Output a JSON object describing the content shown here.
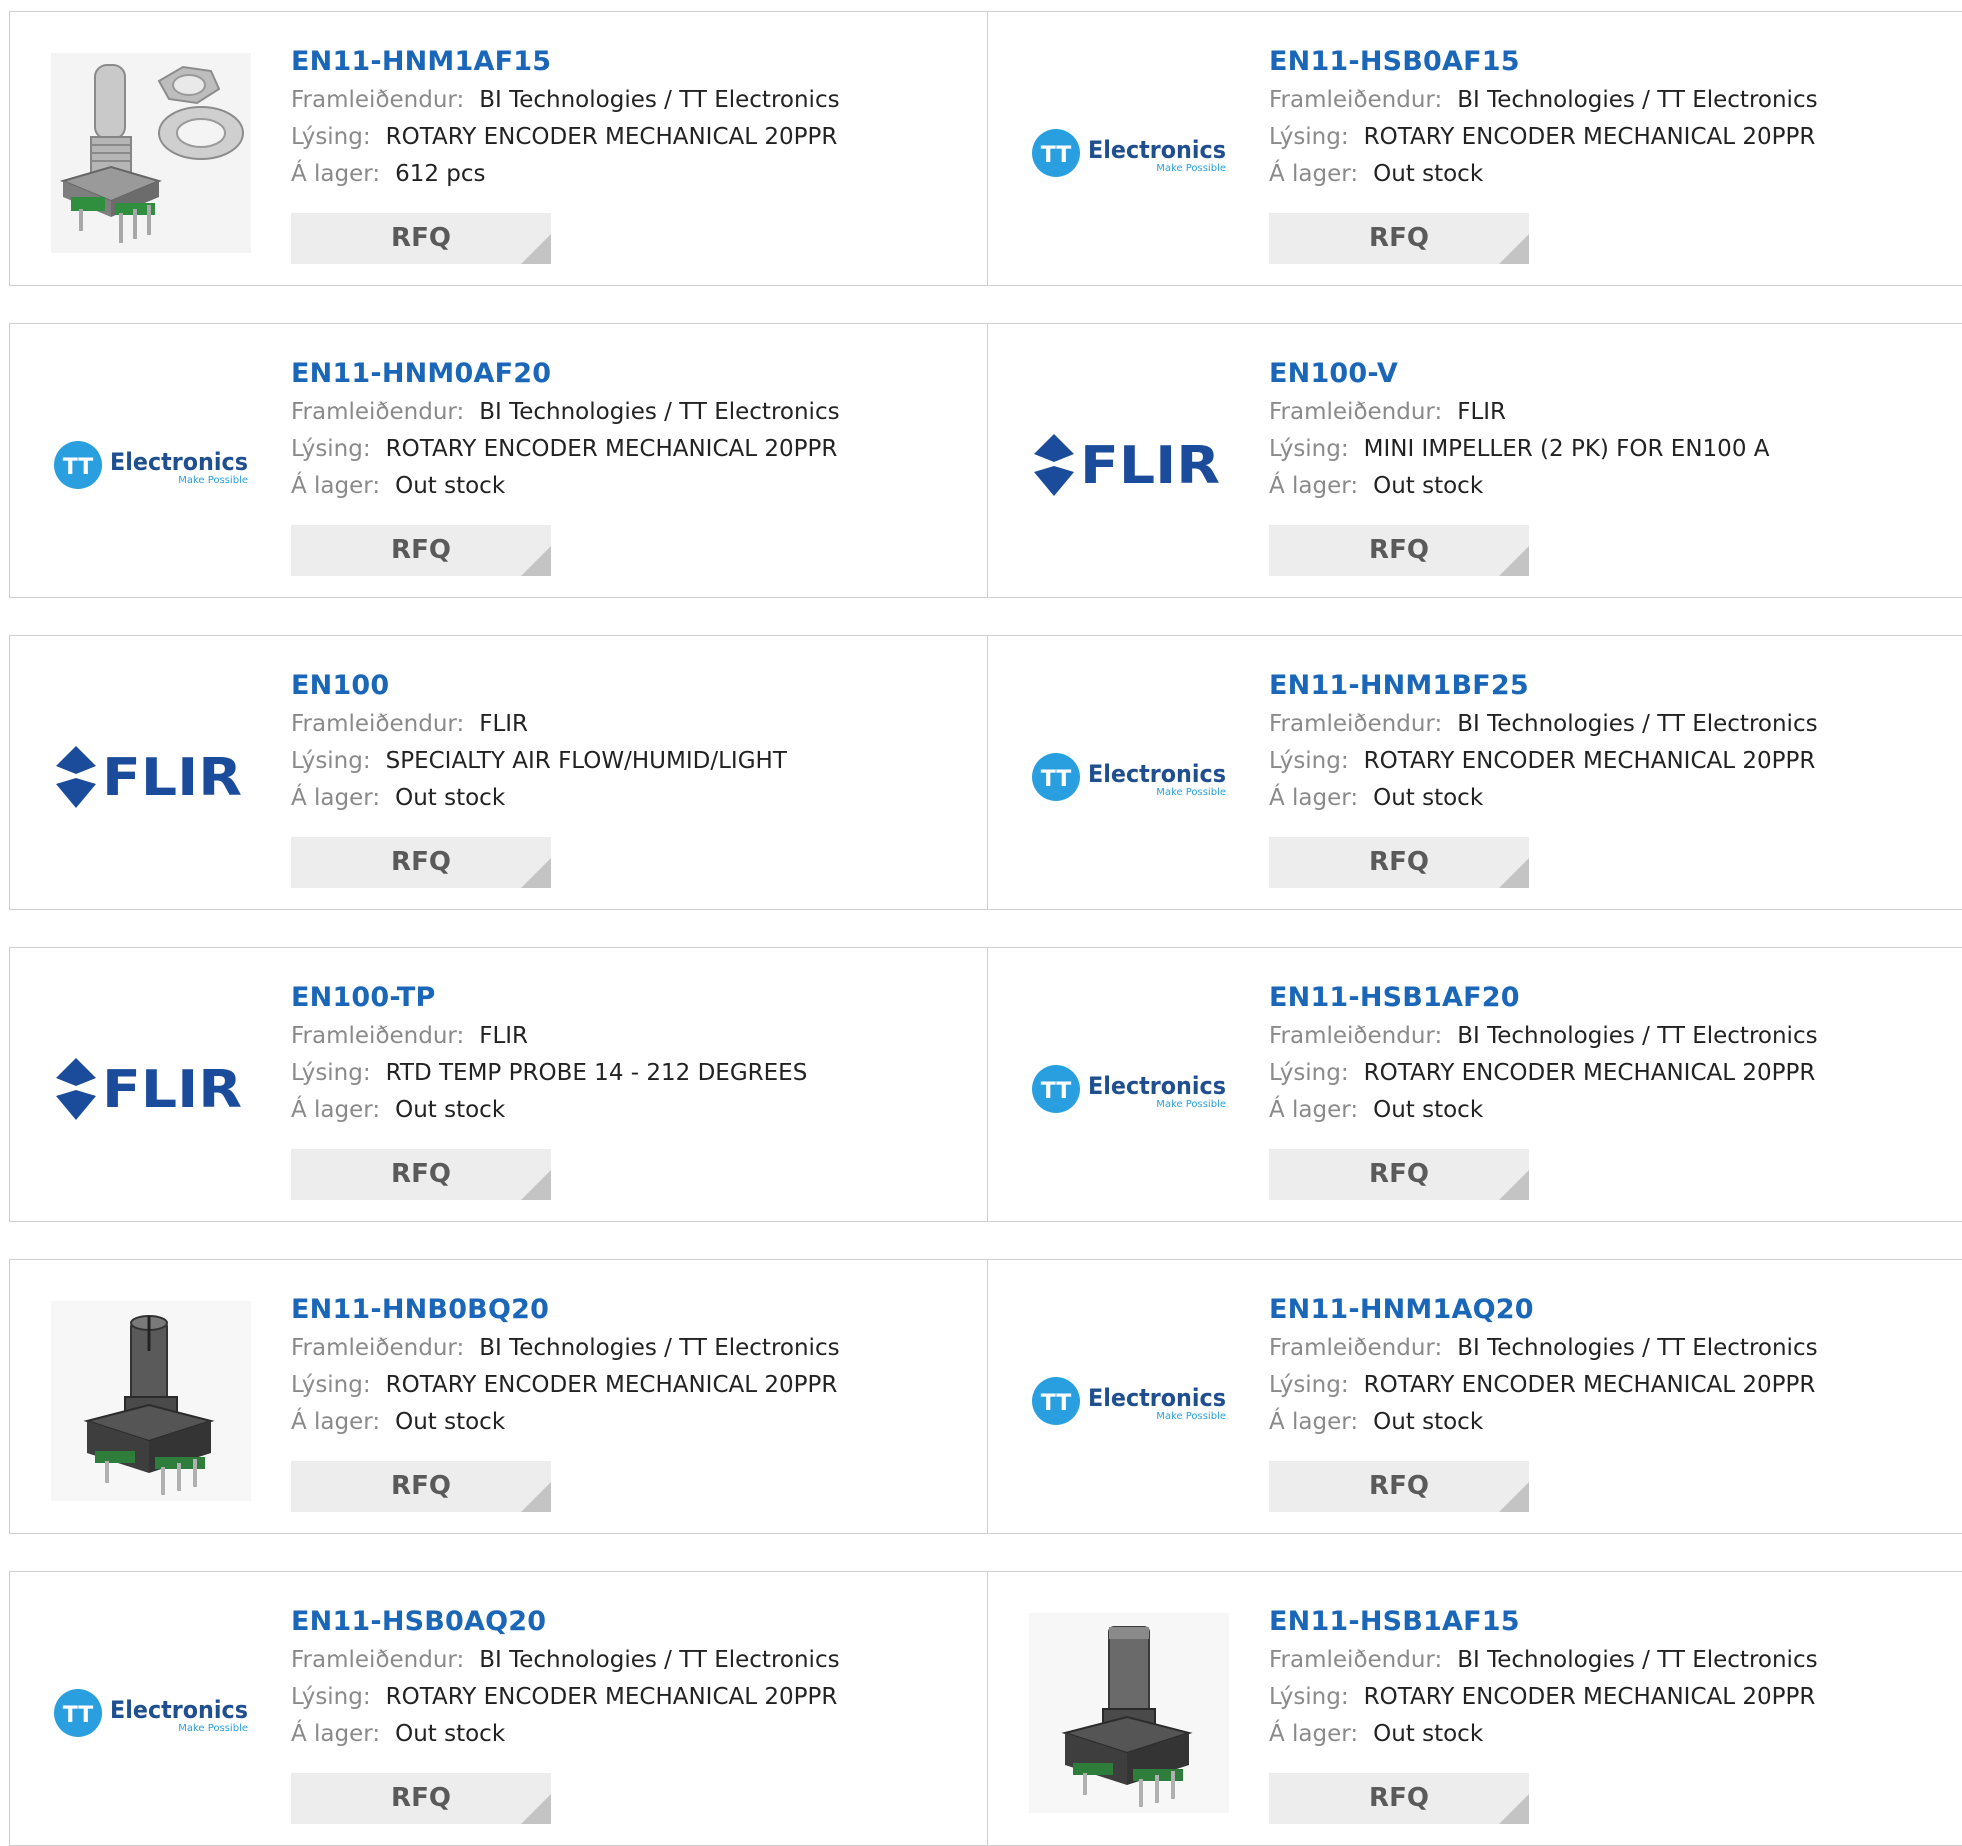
{
  "labels": {
    "manufacturer": "Framleiðendur:",
    "description": "Lýsing:",
    "stock": "Á lager:",
    "rfq": "RFQ"
  },
  "colors": {
    "link": "#1a66b8",
    "label": "#8a8a8a",
    "border": "#cfcfcf",
    "button_bg": "#ededed",
    "tt_blue": "#2a9fe0",
    "flir_blue": "#1b4c9c"
  },
  "brands": {
    "tt": {
      "name": "Electronics",
      "tagline": "Make Possible",
      "mark": "TT"
    },
    "flir": {
      "name": "FLIR"
    }
  },
  "products": [
    {
      "part": "EN11-HNM1AF15",
      "manufacturer": "BI Technologies / TT Electronics",
      "description": "ROTARY ENCODER MECHANICAL 20PPR",
      "stock": "612 pcs",
      "image": "encoder-with-nut-photo"
    },
    {
      "part": "EN11-HSB0AF15",
      "manufacturer": "BI Technologies / TT Electronics",
      "description": "ROTARY ENCODER MECHANICAL 20PPR",
      "stock": "Out stock",
      "image": "tt-electronics-logo"
    },
    {
      "part": "EN11-HNM0AF20",
      "manufacturer": "BI Technologies / TT Electronics",
      "description": "ROTARY ENCODER MECHANICAL 20PPR",
      "stock": "Out stock",
      "image": "tt-electronics-logo"
    },
    {
      "part": "EN100-V",
      "manufacturer": "FLIR",
      "description": "MINI IMPELLER (2 PK) FOR EN100 A",
      "stock": "Out stock",
      "image": "flir-logo"
    },
    {
      "part": "EN100",
      "manufacturer": "FLIR",
      "description": "SPECIALTY AIR FLOW/HUMID/LIGHT",
      "stock": "Out stock",
      "image": "flir-logo"
    },
    {
      "part": "EN11-HNM1BF25",
      "manufacturer": "BI Technologies / TT Electronics",
      "description": "ROTARY ENCODER MECHANICAL 20PPR",
      "stock": "Out stock",
      "image": "tt-electronics-logo"
    },
    {
      "part": "EN100-TP",
      "manufacturer": "FLIR",
      "description": "RTD TEMP PROBE 14 - 212 DEGREES",
      "stock": "Out stock",
      "image": "flir-logo"
    },
    {
      "part": "EN11-HSB1AF20",
      "manufacturer": "BI Technologies / TT Electronics",
      "description": "ROTARY ENCODER MECHANICAL 20PPR",
      "stock": "Out stock",
      "image": "tt-electronics-logo"
    },
    {
      "part": "EN11-HNB0BQ20",
      "manufacturer": "BI Technologies / TT Electronics",
      "description": "ROTARY ENCODER MECHANICAL 20PPR",
      "stock": "Out stock",
      "image": "encoder-slotted-photo"
    },
    {
      "part": "EN11-HNM1AQ20",
      "manufacturer": "BI Technologies / TT Electronics",
      "description": "ROTARY ENCODER MECHANICAL 20PPR",
      "stock": "Out stock",
      "image": "tt-electronics-logo"
    },
    {
      "part": "EN11-HSB0AQ20",
      "manufacturer": "BI Technologies / TT Electronics",
      "description": "ROTARY ENCODER MECHANICAL 20PPR",
      "stock": "Out stock",
      "image": "tt-electronics-logo"
    },
    {
      "part": "EN11-HSB1AF15",
      "manufacturer": "BI Technologies / TT Electronics",
      "description": "ROTARY ENCODER MECHANICAL 20PPR",
      "stock": "Out stock",
      "image": "encoder-dshaft-photo"
    }
  ]
}
